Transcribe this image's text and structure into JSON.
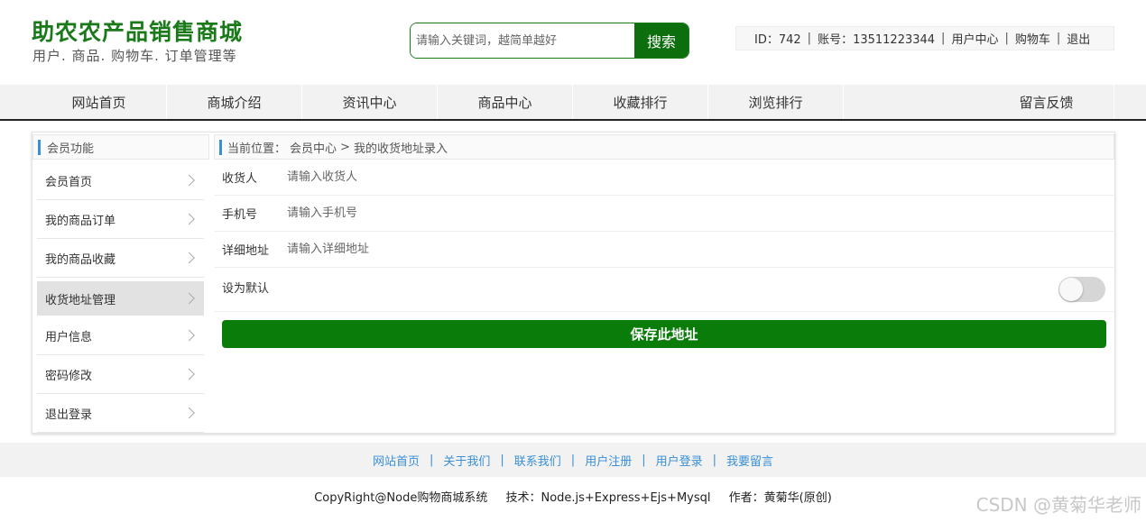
{
  "header": {
    "title": "助农农产品销售商城",
    "subtitle": "用户. 商品. 购物车. 订单管理等",
    "search_placeholder": "请输入关键词，越简单越好",
    "search_button": "搜索",
    "user_id": "ID：742",
    "account": "账号：13511223344",
    "user_center": "用户中心",
    "cart": "购物车",
    "logout": "退出",
    "separator": "|"
  },
  "nav": {
    "items": [
      "网站首页",
      "商城介绍",
      "资讯中心",
      "商品中心",
      "收藏排行",
      "浏览排行",
      "留言反馈"
    ]
  },
  "sidebar": {
    "heading": "会员功能",
    "items": [
      {
        "label": "会员首页"
      },
      {
        "label": "我的商品订单"
      },
      {
        "label": "我的商品收藏"
      },
      {
        "label": "收货地址管理"
      },
      {
        "label": "用户信息"
      },
      {
        "label": "密码修改"
      },
      {
        "label": "退出登录"
      }
    ]
  },
  "breadcrumb": {
    "prefix": "当前位置：",
    "level1": "会员中心",
    "arrow": ">",
    "level2": "我的收货地址录入"
  },
  "form": {
    "receiver_label": "收货人",
    "receiver_placeholder": "请输入收货人",
    "phone_label": "手机号",
    "phone_placeholder": "请输入手机号",
    "address_label": "详细地址",
    "address_placeholder": "请输入详细地址",
    "default_label": "设为默认",
    "default_on": false,
    "save_button": "保存此地址"
  },
  "footer": {
    "links": [
      "网站首页",
      "关于我们",
      "联系我们",
      "用户注册",
      "用户登录",
      "我要留言"
    ],
    "separator": "|",
    "copyright": "CopyRight@Node购物商城系统",
    "tech": "技术：Node.js+Express+Ejs+Mysql",
    "author": "作者：黄菊华(原创)"
  },
  "watermark": "CSDN @黄菊华老师",
  "colors": {
    "brand_green": "#1a7a1a",
    "button_green": "#0a7c0a",
    "link_blue": "#3a8fd6"
  }
}
